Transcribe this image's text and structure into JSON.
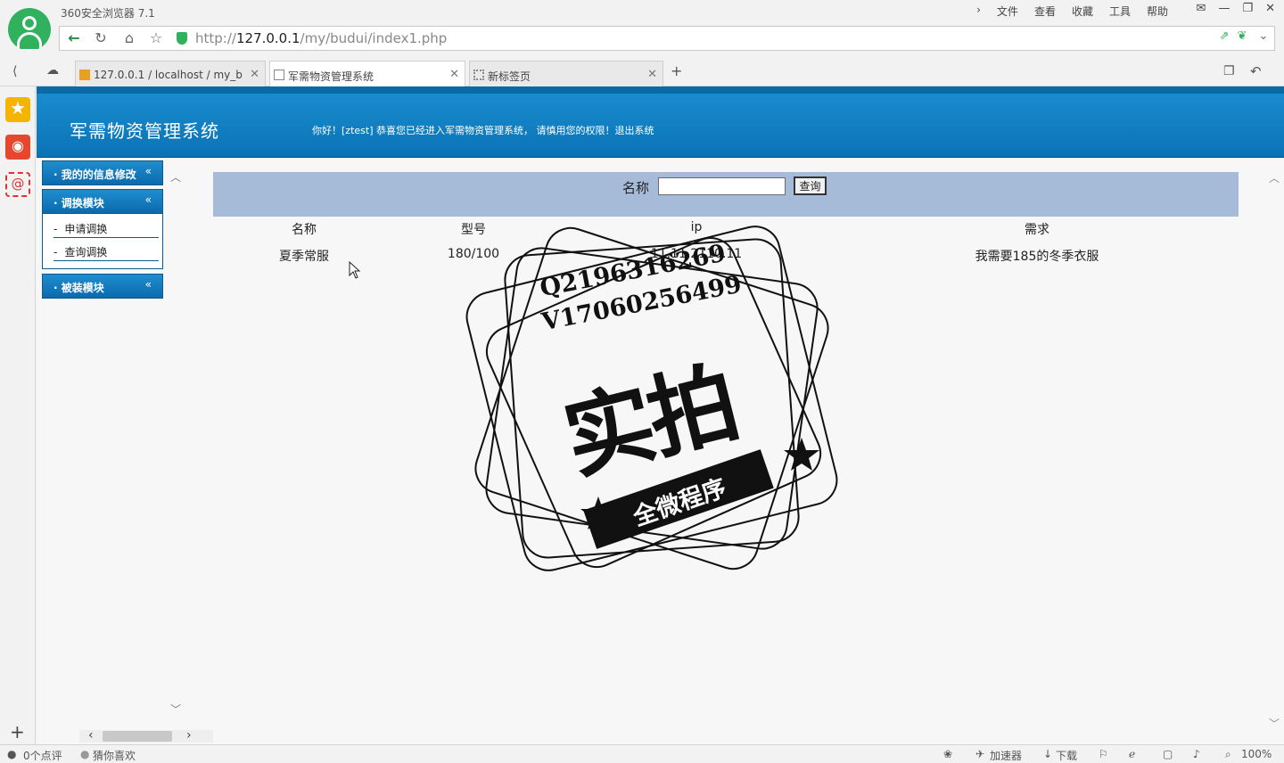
{
  "browser": {
    "app_title": "360安全浏览器 7.1",
    "menu": [
      "文件",
      "查看",
      "收藏",
      "工具",
      "帮助"
    ],
    "url_prefix": "http://",
    "url_host": "127.0.0.1",
    "url_path": "/my/budui/index1.php",
    "tabs": [
      {
        "label": "127.0.0.1 / localhost / my_b"
      },
      {
        "label": "军需物资管理系统"
      },
      {
        "label": "新标签页"
      }
    ],
    "status": {
      "comments": "0个点评",
      "guess": "猜你喜欢",
      "accelerator": "加速器",
      "download": "下载",
      "zoom": "100%"
    }
  },
  "page": {
    "system_title": "军需物资管理系统",
    "welcome": "你好！[ztest] 恭喜您已经进入军需物资管理系统， 请慎用您的权限！退出系统",
    "modules": [
      {
        "label": "· 我的的信息修改"
      },
      {
        "label": "· 调换模块"
      },
      {
        "label": "· 被装模块"
      }
    ],
    "submenu": [
      "申请调换",
      "查询调换"
    ],
    "search": {
      "label": "名称",
      "value": "",
      "button": "查询"
    },
    "table": {
      "headers": [
        "名称",
        "型号",
        "ip",
        "需求"
      ],
      "rows": [
        [
          "夏季常服",
          "180/100",
          "11.11.2110.11",
          "我需要185的冬季衣服"
        ]
      ]
    }
  },
  "watermark": {
    "line1": "Q2196316269",
    "line2": "V17060256499",
    "big": "实拍",
    "ribbon": "全微程序"
  }
}
